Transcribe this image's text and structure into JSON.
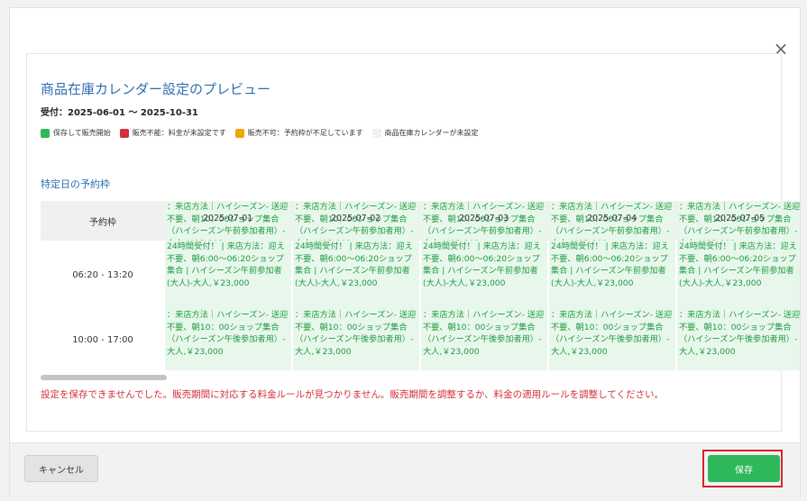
{
  "modal": {
    "title": "商品在庫カレンダー設定のプレビュー",
    "date_range": "受付：2025-06-01 〜 2025-10-31",
    "legend": [
      {
        "label": "保存して販売開始",
        "color": "#2fb85b"
      },
      {
        "label": "販売不能：料金が未設定です",
        "color": "#d2303b"
      },
      {
        "label": "販売不可：予約枠が不足しています",
        "color": "#f0a500"
      },
      {
        "label": "商品在庫カレンダーが未設定",
        "color": "#e6e6e6"
      }
    ],
    "section_title": "特定日の予約枠",
    "table": {
      "header_label": "予約枠",
      "dates": [
        "2025-07-01",
        "2025-07-02",
        "2025-07-03",
        "2025-07-04",
        "2025-07-05"
      ],
      "rows": [
        {
          "label": "06:20 - 13:20",
          "text": "24時間受付！ | 来店方法：迎え不要、朝6:00〜06:20ショップ集合 | ハイシーズン午前参加者(大人)-大人,￥23,000"
        },
        {
          "label": "10:00 - 17:00",
          "text": "：来店方法｜ハイシーズン- 送迎不要、朝10：00ショップ集合（ハイシーズン午後参加者用）-大人,￥23,000"
        }
      ],
      "header_cell_text": "：来店方法｜ハイシーズン- 送迎不要、朝10：00ショップ集合（ハイシーズン午前参加者用）-大人,￥23,000"
    },
    "error_message": "設定を保存できませんでした。販売期間に対応する料金ルールが見つかりません。販売期間を調整するか、料金の適用ルールを調整してください。",
    "close_icon": "×"
  },
  "footer": {
    "cancel_label": "キャンセル",
    "save_label": "保存"
  }
}
